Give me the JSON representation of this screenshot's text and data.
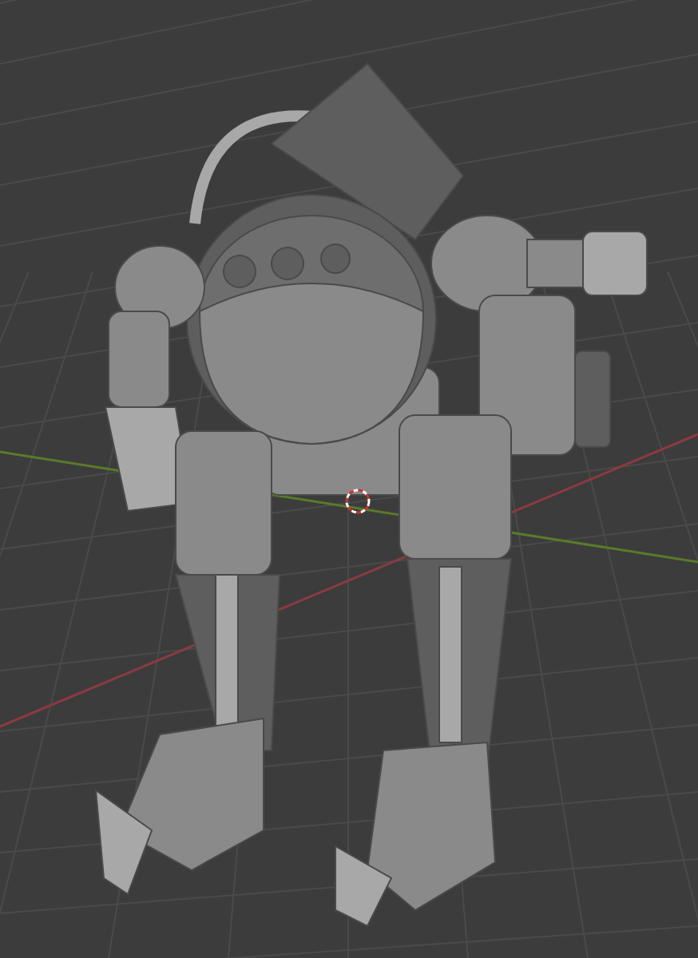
{
  "viewport": {
    "grid": true,
    "x_axis": true,
    "y_axis": true,
    "cursor_3d": true
  },
  "model": {
    "kind": "robot"
  }
}
